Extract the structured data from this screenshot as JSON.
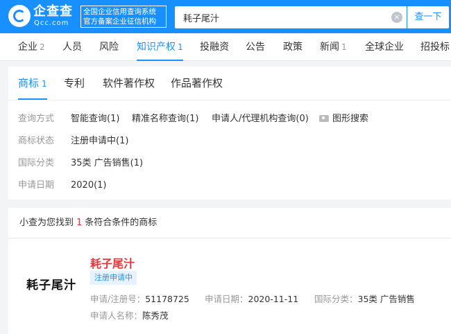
{
  "header": {
    "logo_cn": "企查查",
    "logo_en": "Qcc.com",
    "slogan_line1": "全国企业信用查询系统",
    "slogan_line2": "官方备案企业征信机构",
    "search_value": "耗子尾汁",
    "clear_icon": "×",
    "search_button": "查一下",
    "brand_color": "#1890ff"
  },
  "nav": {
    "items": [
      {
        "label": "企业",
        "count": "2"
      },
      {
        "label": "人员",
        "count": ""
      },
      {
        "label": "风险",
        "count": ""
      },
      {
        "label": "知识产权",
        "count": "1"
      },
      {
        "label": "投融资",
        "count": ""
      },
      {
        "label": "公告",
        "count": ""
      },
      {
        "label": "政策",
        "count": ""
      },
      {
        "label": "新闻",
        "count": "1"
      },
      {
        "label": "全球企业",
        "count": ""
      },
      {
        "label": "招投标",
        "count": ""
      }
    ],
    "active_index": 3
  },
  "subtabs": [
    {
      "label": "商标",
      "count": "1"
    },
    {
      "label": "专利",
      "count": ""
    },
    {
      "label": "软件著作权",
      "count": ""
    },
    {
      "label": "作品著作权",
      "count": ""
    }
  ],
  "filters": {
    "query_mode_label": "查询方式",
    "query_modes": [
      "智能查询(1)",
      "精准名称查询(1)",
      "申请人/代理机构查询(0)"
    ],
    "image_search": "图形搜索",
    "status_label": "商标状态",
    "status_value": "注册申请中(1)",
    "class_label": "国际分类",
    "class_value": "35类 广告销售(1)",
    "date_label": "申请日期",
    "date_value": "2020(1)"
  },
  "summary": {
    "prefix": "小查为您找到",
    "count": "1",
    "suffix": "条符合条件的商标"
  },
  "result": {
    "image_text": "耗子尾汁",
    "name": "耗子尾汁",
    "status": "注册申请中",
    "reg_no_label": "申请/注册号：",
    "reg_no": "51178725",
    "date_label": "申请日期：",
    "date": "2020-11-11",
    "class_label": "国际分类：",
    "class": "35类 广告销售",
    "applicant_label": "申请人名称：",
    "applicant": "陈秀茂"
  }
}
